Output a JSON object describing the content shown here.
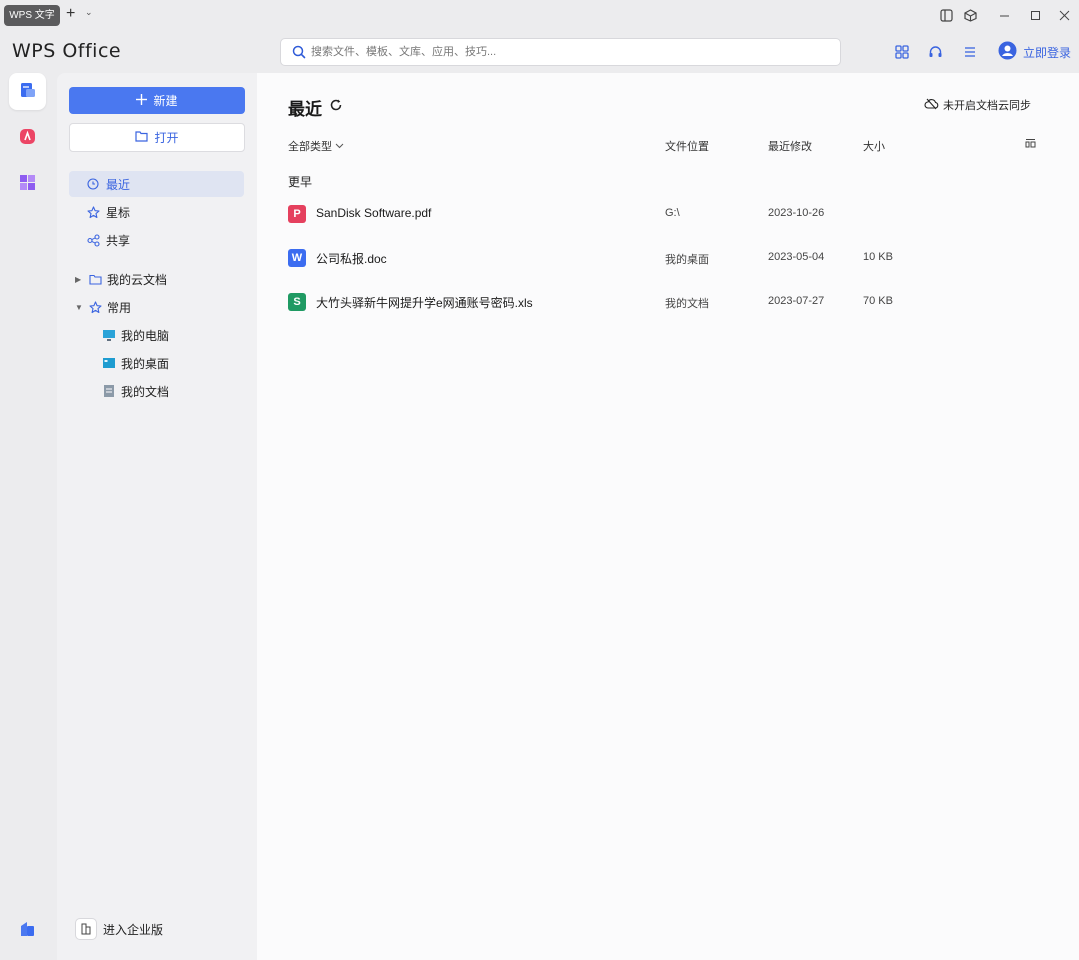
{
  "titlebar": {
    "tab_label": "WPS 文字",
    "add_tab": "+",
    "tab_menu": "⌄"
  },
  "header": {
    "logo": "WPS Office",
    "search_placeholder": "搜索文件、模板、文库、应用、技巧...",
    "login_label": "立即登录"
  },
  "nav": {
    "new_label": "新建",
    "open_label": "打开",
    "items": [
      {
        "label": "最近",
        "icon": "clock-icon"
      },
      {
        "label": "星标",
        "icon": "star-icon"
      },
      {
        "label": "共享",
        "icon": "share-icon"
      }
    ],
    "tree": [
      {
        "label": "我的云文档",
        "arrow": "▶",
        "icon": "folder-icon"
      },
      {
        "label": "常用",
        "arrow": "▼",
        "icon": "star-icon"
      }
    ],
    "common": [
      {
        "label": "我的电脑",
        "icon": "computer-icon"
      },
      {
        "label": "我的桌面",
        "icon": "desktop-icon"
      },
      {
        "label": "我的文档",
        "icon": "document-icon"
      }
    ],
    "enterprise_label": "进入企业版"
  },
  "main": {
    "title": "最近",
    "cloud_sync_label": "未开启文档云同步",
    "filter_label": "全部类型",
    "columns": {
      "location": "文件位置",
      "modified": "最近修改",
      "size": "大小"
    },
    "group_label": "更早",
    "files": [
      {
        "name": "SanDisk Software.pdf",
        "type": "pdf",
        "icon_text": "P",
        "color": "#e5405e",
        "location": "G:\\",
        "modified": "2023-10-26",
        "size": ""
      },
      {
        "name": "公司私报.doc",
        "type": "doc",
        "icon_text": "W",
        "color": "#3b6cf0",
        "location": "我的桌面",
        "modified": "2023-05-04",
        "size": "10 KB"
      },
      {
        "name": "大竹头驿新牛网提升学e网通账号密码.xls",
        "type": "xls",
        "icon_text": "S",
        "color": "#1f9a63",
        "location": "我的文档",
        "modified": "2023-07-27",
        "size": "70 KB"
      }
    ]
  },
  "colors": {
    "accent": "#4a78f0",
    "link": "#3a64e0",
    "active_bg": "#dfe4f2"
  }
}
